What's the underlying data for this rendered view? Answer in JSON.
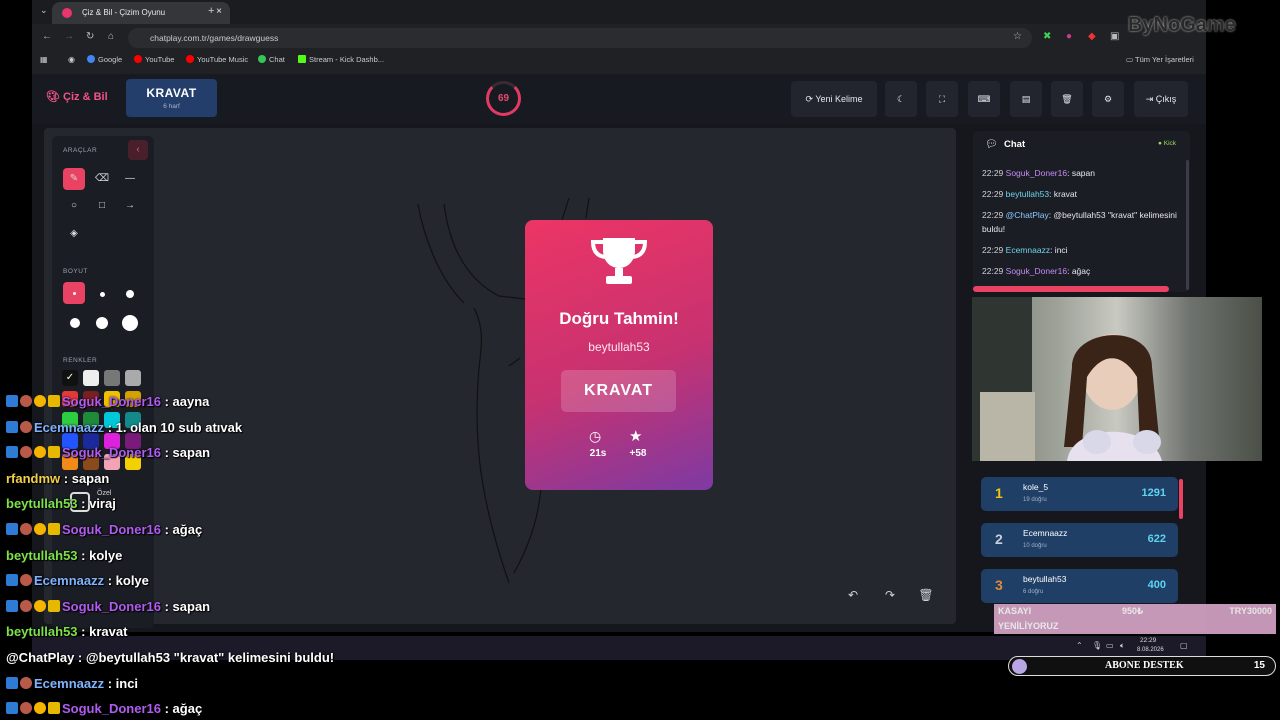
{
  "browser": {
    "tab_title": "Çiz & Bil - Çizim Oyunu",
    "tab_close": "×",
    "new_tab": "+",
    "url": "chatplay.com.tr/games/drawguess",
    "bookmarks": [
      {
        "label": "Google",
        "color": "#4285f4"
      },
      {
        "label": "YouTube",
        "color": "#ff0000"
      },
      {
        "label": "YouTube Music",
        "color": "#ff0000"
      },
      {
        "label": "Chat",
        "color": "#34c759"
      },
      {
        "label": "Stream - Kick Dashb...",
        "color": "#53fc18"
      }
    ],
    "all_bookmarks": "Tüm Yer İşaretleri",
    "watermark": "ByNoGame"
  },
  "header": {
    "brand": "Çiz & Bil",
    "word": "KRAVAT",
    "word_hint": "6 harf",
    "timer": "69",
    "new_word_label": "Yeni Kelime",
    "exit_label": "Çıkış"
  },
  "tools": {
    "tools_label": "ARAÇLAR",
    "size_label": "BOYUT",
    "colors_label": "RENKLER",
    "special_label": "Özel",
    "colors": [
      "#111111",
      "#eeeeee",
      "#777777",
      "#aaaaaa",
      "#e53935",
      "#7a1f1f",
      "#f0c000",
      "#d4a100",
      "#2ecc40",
      "#1f8a3a",
      "#00c8d8",
      "#138a8a",
      "#2255ff",
      "#1a2a9a",
      "#dd22dd",
      "#7a1a7a",
      "#f28a1a",
      "#8a4a1a",
      "#f4a3b6",
      "#f3d000"
    ]
  },
  "card": {
    "title": "Doğru Tahmin!",
    "user": "beytullah53",
    "word": "KRAVAT",
    "time": "21s",
    "points": "+58"
  },
  "chat": {
    "title": "Chat",
    "platform": "Kick",
    "messages": [
      {
        "time": "22:29",
        "user": "Soguk_Doner16",
        "text": ": sapan"
      },
      {
        "time": "22:29",
        "user": "beytullah53",
        "text": ": kravat"
      },
      {
        "time": "22:29",
        "user": "@ChatPlay",
        "text": ": @beytullah53 \"kravat\" kelimesini buldu!"
      },
      {
        "time": "22:29",
        "user": "Ecemnaazz",
        "text": ": inci"
      },
      {
        "time": "22:29",
        "user": "Soguk_Doner16",
        "text": ": ağaç"
      }
    ],
    "progress": 0.95
  },
  "leaderboard": [
    {
      "rank": "1",
      "name": "kole_5",
      "detail": "19 doğru",
      "points": "1291",
      "color": "#f1c40f"
    },
    {
      "rank": "2",
      "name": "Ecemnaazz",
      "detail": "10 doğru",
      "points": "622",
      "color": "#c8d0dc"
    },
    {
      "rank": "3",
      "name": "beytullah53",
      "detail": "6 doğru",
      "points": "400",
      "color": "#e08a3a"
    }
  ],
  "kasa": {
    "left": "KASAYI",
    "left2": "YENİLİYORUZ",
    "mid": "950₺",
    "right": "TRY30000"
  },
  "taskbar": {
    "time": "22:29",
    "date": "8.08.2026"
  },
  "abone": {
    "label": "ABONE DESTEK",
    "count": "15"
  },
  "overlay": [
    {
      "user": "Soguk_Doner16",
      "text": " : aayna",
      "style": "purple",
      "badges": true
    },
    {
      "user": "Ecemnaazz",
      "text": " : 1. olan 10 sub atıvak",
      "style": "blue",
      "badges": "partial"
    },
    {
      "user": "Soguk_Doner16",
      "text": " : sapan",
      "style": "purple",
      "badges": true
    },
    {
      "user": "rfandmw",
      "text": " : sapan",
      "style": "green-name-yellow",
      "badges": false
    },
    {
      "user": "beytullah53",
      "text": " : viraj",
      "style": "green",
      "badges": false
    },
    {
      "user": "Soguk_Doner16",
      "text": " : ağaç",
      "style": "purple",
      "badges": true
    },
    {
      "user": "beytullah53",
      "text": " : kolye",
      "style": "green",
      "badges": false
    },
    {
      "user": "Ecemnaazz",
      "text": " : kolye",
      "style": "blue",
      "badges": "partial"
    },
    {
      "user": "Soguk_Doner16",
      "text": " : sapan",
      "style": "purple",
      "badges": true
    },
    {
      "user": "beytullah53",
      "text": " : kravat",
      "style": "green",
      "badges": false
    },
    {
      "user": "@ChatPlay",
      "text": " : @beytullah53 \"kravat\" kelimesini buldu!",
      "style": "white",
      "badges": false
    },
    {
      "user": "Ecemnaazz",
      "text": " : inci",
      "style": "blue",
      "badges": "partial"
    },
    {
      "user": "Soguk_Doner16",
      "text": " : ağaç",
      "style": "purple",
      "badges": true
    }
  ]
}
